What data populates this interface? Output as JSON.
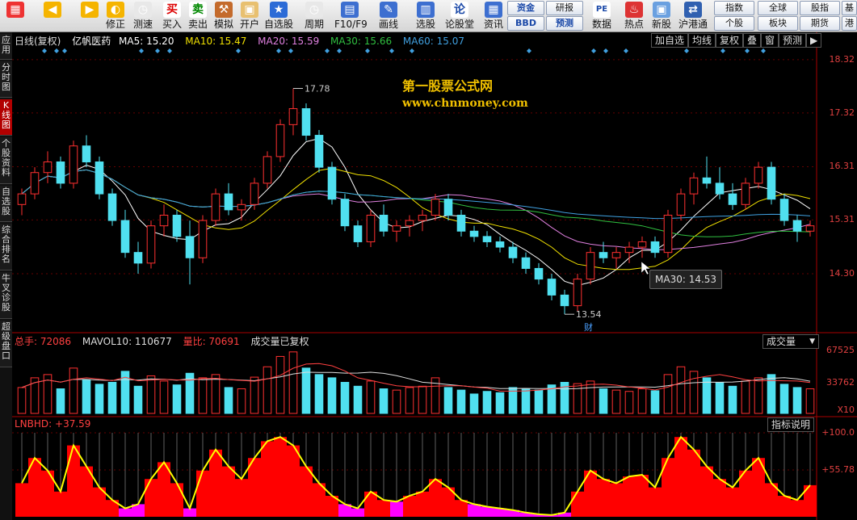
{
  "toolbar": {
    "buttons": [
      {
        "label": "",
        "icon": "grid-icon"
      },
      {
        "label": "",
        "icon": "back-arrow-icon"
      },
      {
        "label": "",
        "icon": "forward-arrow-icon"
      },
      {
        "label": "修正",
        "icon": "fix-icon"
      },
      {
        "label": "测速",
        "icon": "clock-icon"
      },
      {
        "label": "买入",
        "icon": "buy-icon",
        "glyph": "买"
      },
      {
        "label": "卖出",
        "icon": "sell-icon",
        "glyph": "卖"
      },
      {
        "label": "模拟",
        "icon": "hammer-icon"
      },
      {
        "label": "开户",
        "icon": "lock-icon"
      },
      {
        "label": "自选股",
        "icon": "star-icon"
      },
      {
        "label": "周期",
        "icon": "clock-icon"
      },
      {
        "label": "F10/F9",
        "icon": "document-icon"
      },
      {
        "label": "画线",
        "icon": "pen-icon"
      },
      {
        "label": "选股",
        "icon": "screen-icon"
      },
      {
        "label": "论股堂",
        "icon": "discuss-icon",
        "glyph": "论"
      },
      {
        "label": "资讯",
        "icon": "info-icon"
      }
    ],
    "small_buttons": [
      {
        "label": "资金",
        "style": "blue"
      },
      {
        "label": "BBD",
        "style": "blue"
      },
      {
        "label": "研报",
        "style": "dark"
      },
      {
        "label": "预测",
        "style": "blue"
      }
    ],
    "buttons2": [
      {
        "label": "数据",
        "icon": "pe-icon",
        "glyph": "PE"
      },
      {
        "label": "热点",
        "icon": "hot-icon"
      },
      {
        "label": "新股",
        "icon": "ipo-icon"
      },
      {
        "label": "沪港通",
        "icon": "sh-hk-icon"
      }
    ],
    "right_buttons": [
      {
        "label": "指数"
      },
      {
        "label": "全球"
      },
      {
        "label": "股指"
      },
      {
        "label": "基"
      },
      {
        "label": "个股"
      },
      {
        "label": "板块"
      },
      {
        "label": "期货"
      },
      {
        "label": "港"
      }
    ]
  },
  "left_tabs": [
    {
      "label": "应用",
      "active": false
    },
    {
      "label": "分时图",
      "active": false
    },
    {
      "label": "K线图",
      "active": true
    },
    {
      "label": "个股资料",
      "active": false
    },
    {
      "label": "自选股",
      "active": false
    },
    {
      "label": "综合排名",
      "active": false
    },
    {
      "label": "牛叉诊股",
      "active": false
    },
    {
      "label": "超级盘口",
      "active": false
    }
  ],
  "price_header": {
    "period": "日线(复权)",
    "stock": "亿帆医药",
    "ma5": "MA5: 15.20",
    "ma10": "MA10: 15.47",
    "ma20": "MA20: 15.59",
    "ma30": "MA30: 15.66",
    "ma60": "MA60: 15.07",
    "buttons": [
      "加自选",
      "均线",
      "复权",
      "叠",
      "窗",
      "预测",
      "▶"
    ]
  },
  "colors": {
    "ma5": "#ffffff",
    "ma10": "#f0e000",
    "ma20": "#e080e0",
    "ma30": "#30c040",
    "ma60": "#40a0e0",
    "up": "#ff3030",
    "down": "#50e0f0",
    "lnbhd_line": "#ffff00",
    "lnbhd_fill": "#ff0000",
    "lnbhd_low": "#ff00ff"
  },
  "price_axis": [
    "18.32",
    "17.32",
    "16.31",
    "15.31",
    "14.30"
  ],
  "annotations": {
    "high": "17.78",
    "low": "13.54",
    "finance_mark": "财"
  },
  "watermark": {
    "line1": "第一股票公式网",
    "line2": "www.chnmoney.com"
  },
  "tooltip": "MA30: 14.53",
  "volume_header": {
    "total": "总手: 72086",
    "mavol10": "MAVOL10: 110677",
    "ratio": "量比: 70691",
    "note": "成交量已复权",
    "selector": "成交量"
  },
  "volume_axis": [
    "67525",
    "33762",
    "X10"
  ],
  "indicator_header": {
    "name": "LNBHD: +37.59",
    "help_button": "指标说明"
  },
  "indicator_axis": [
    "+100.0",
    "+55.78"
  ],
  "chart_data": {
    "type": "candlestick",
    "stock": "亿帆医药",
    "ylim": [
      13.3,
      18.5
    ],
    "candles": [
      [
        15.6,
        15.9,
        15.4,
        15.8
      ],
      [
        15.8,
        16.3,
        15.7,
        16.2
      ],
      [
        16.2,
        16.6,
        16.0,
        16.4
      ],
      [
        16.4,
        16.5,
        15.9,
        16.0
      ],
      [
        16.0,
        16.8,
        15.9,
        16.7
      ],
      [
        16.7,
        16.9,
        16.3,
        16.4
      ],
      [
        16.4,
        16.5,
        15.7,
        15.8
      ],
      [
        15.8,
        15.9,
        15.2,
        15.3
      ],
      [
        15.3,
        15.5,
        14.6,
        14.7
      ],
      [
        14.7,
        14.9,
        14.3,
        14.5
      ],
      [
        14.5,
        15.3,
        14.4,
        15.2
      ],
      [
        15.2,
        15.6,
        15.0,
        15.4
      ],
      [
        15.4,
        15.5,
        14.9,
        15.0
      ],
      [
        15.0,
        15.3,
        14.1,
        14.6
      ],
      [
        14.6,
        15.4,
        14.5,
        15.3
      ],
      [
        15.3,
        15.9,
        15.2,
        15.8
      ],
      [
        15.8,
        16.0,
        15.4,
        15.5
      ],
      [
        15.5,
        15.7,
        15.3,
        15.6
      ],
      [
        15.6,
        16.1,
        15.5,
        16.0
      ],
      [
        16.0,
        16.6,
        15.9,
        16.5
      ],
      [
        16.5,
        17.2,
        16.4,
        17.1
      ],
      [
        17.1,
        17.78,
        16.9,
        17.4
      ],
      [
        17.4,
        17.5,
        16.8,
        16.9
      ],
      [
        16.9,
        17.0,
        16.2,
        16.3
      ],
      [
        16.3,
        16.4,
        15.6,
        15.7
      ],
      [
        15.7,
        15.8,
        15.1,
        15.2
      ],
      [
        15.2,
        15.3,
        14.8,
        14.9
      ],
      [
        14.9,
        15.5,
        14.8,
        15.4
      ],
      [
        15.4,
        15.6,
        15.0,
        15.1
      ],
      [
        15.1,
        15.3,
        14.9,
        15.2
      ],
      [
        15.2,
        15.4,
        15.0,
        15.3
      ],
      [
        15.3,
        15.5,
        15.1,
        15.4
      ],
      [
        15.4,
        15.8,
        15.3,
        15.7
      ],
      [
        15.7,
        15.8,
        15.3,
        15.4
      ],
      [
        15.4,
        15.5,
        15.0,
        15.1
      ],
      [
        15.1,
        15.2,
        14.9,
        15.0
      ],
      [
        15.0,
        15.1,
        14.8,
        14.9
      ],
      [
        14.9,
        15.0,
        14.7,
        14.8
      ],
      [
        14.8,
        14.9,
        14.5,
        14.6
      ],
      [
        14.6,
        14.7,
        14.3,
        14.4
      ],
      [
        14.4,
        14.5,
        14.1,
        14.2
      ],
      [
        14.2,
        14.3,
        13.8,
        13.9
      ],
      [
        13.9,
        14.0,
        13.54,
        13.7
      ],
      [
        13.7,
        14.3,
        13.6,
        14.2
      ],
      [
        14.2,
        14.8,
        14.1,
        14.7
      ],
      [
        14.7,
        14.9,
        14.5,
        14.6
      ],
      [
        14.6,
        14.8,
        14.4,
        14.7
      ],
      [
        14.7,
        14.9,
        14.5,
        14.8
      ],
      [
        14.8,
        15.0,
        14.6,
        14.9
      ],
      [
        14.9,
        15.0,
        14.6,
        14.7
      ],
      [
        14.7,
        15.5,
        14.6,
        15.4
      ],
      [
        15.4,
        15.9,
        15.3,
        15.8
      ],
      [
        15.8,
        16.2,
        15.6,
        16.1
      ],
      [
        16.1,
        16.5,
        15.9,
        16.0
      ],
      [
        16.0,
        16.3,
        15.7,
        15.8
      ],
      [
        15.8,
        16.0,
        15.5,
        15.6
      ],
      [
        15.6,
        16.1,
        15.5,
        16.0
      ],
      [
        16.0,
        16.4,
        15.9,
        16.3
      ],
      [
        16.3,
        16.4,
        15.6,
        15.7
      ],
      [
        15.7,
        15.8,
        15.2,
        15.3
      ],
      [
        15.3,
        15.4,
        14.9,
        15.1
      ],
      [
        15.1,
        15.3,
        15.0,
        15.2
      ]
    ],
    "volume": [
      40,
      55,
      60,
      38,
      70,
      52,
      45,
      48,
      65,
      42,
      58,
      50,
      44,
      62,
      55,
      60,
      40,
      38,
      56,
      72,
      88,
      95,
      70,
      60,
      55,
      48,
      42,
      50,
      38,
      36,
      40,
      42,
      55,
      40,
      36,
      30,
      34,
      32,
      40,
      38,
      36,
      44,
      48,
      46,
      50,
      38,
      36,
      34,
      38,
      35,
      60,
      72,
      65,
      55,
      48,
      42,
      50,
      55,
      60,
      45,
      40,
      38
    ],
    "lnbhd": [
      40,
      70,
      55,
      30,
      85,
      60,
      35,
      20,
      10,
      15,
      45,
      65,
      40,
      10,
      55,
      80,
      60,
      45,
      70,
      90,
      95,
      85,
      60,
      40,
      25,
      15,
      10,
      30,
      20,
      18,
      25,
      30,
      45,
      35,
      20,
      15,
      12,
      10,
      8,
      5,
      3,
      2,
      5,
      30,
      55,
      45,
      40,
      48,
      50,
      35,
      70,
      95,
      80,
      60,
      45,
      35,
      55,
      70,
      40,
      25,
      20,
      37.59
    ]
  }
}
